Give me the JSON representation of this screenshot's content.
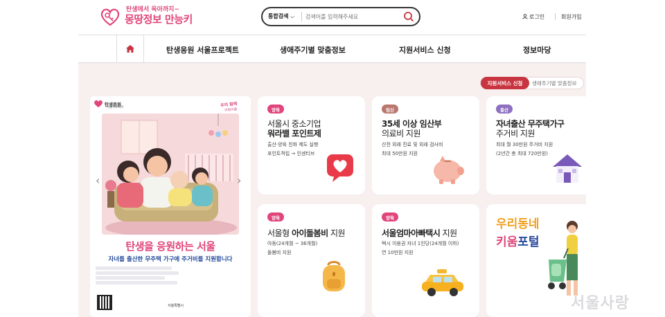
{
  "header": {
    "logo_tagline": "탄생에서 육아까지~",
    "logo_name": "몽땅정보 만능키",
    "search_scope": "통합검색",
    "search_placeholder": "검색어를 입력해주세요",
    "login": "로그인",
    "join": "회원가입"
  },
  "nav": {
    "items": [
      "탄생응원 서울프로젝트",
      "생애주기별 맞춤정보",
      "지원서비스 신청",
      "정보마당"
    ]
  },
  "toggle": {
    "active": "지원서비스 신청",
    "inactive": "생애주기별 맞춤정보"
  },
  "poster": {
    "logo": "탄생응원",
    "logo_sub": "서울프로젝트",
    "tag_line1": "우리 함께",
    "tag_line2": "키워서울",
    "title": "탄생을 응원하는 서울",
    "subtitle": "자녀를 출산한 무주택 가구에 주거비를 지원합니다",
    "footer": "서울특별시"
  },
  "cards": [
    {
      "badge": "양육",
      "badge_color": "#e0457b",
      "title_regular": "서울시 중소기업",
      "title_bold": "워라밸 포인트제",
      "desc": [
        "출산·양육 친화 제도 실행",
        "포인트적립 → 인센티브"
      ],
      "icon": "heart-bubble-icon"
    },
    {
      "badge": "임신",
      "badge_color": "#b9776e",
      "title_regular": "",
      "title_bold": "35세 이상 임산부",
      "title_line2": "의료비 지원",
      "desc": [
        "산전 외래 진료 및 외래 검사비",
        "최대 50만원 지원"
      ],
      "icon": "piggy-bank-icon"
    },
    {
      "badge": "출산",
      "badge_color": "#8e6fc0",
      "title_regular": "",
      "title_bold": "자녀출산 무주택가구",
      "title_line2": "주거비 지원",
      "desc": [
        "최대 월 30만원 주거비 지원",
        "(2년간 총 최대 720만원)"
      ],
      "icon": "house-icon"
    },
    {
      "badge": "양육",
      "badge_color": "#e0457b",
      "title_regular": "서울형 ",
      "title_bold": "아이돌봄비",
      "title_after": " 지원",
      "desc": [
        "아동(24개월 ~ 36개월)",
        "돌봄비 지원"
      ],
      "icon": "backpack-icon"
    },
    {
      "badge": "양육",
      "badge_color": "#e0457b",
      "title_regular": "",
      "title_bold": "서울엄마아빠택시",
      "title_after": " 지원",
      "desc": [
        "택시 이용권 자녀 1인당(24개월 이하)",
        "연 10만원 지원"
      ],
      "icon": "taxi-icon"
    },
    {
      "big_line1": "우리동네",
      "big_line2_a": "키움",
      "big_line2_b": "포털",
      "icon": "stroller-icon"
    }
  ],
  "watermark": "서울사랑",
  "colors": {
    "accent": "#e0457b",
    "brand_red": "#c8343f",
    "background": "#f8efef"
  }
}
